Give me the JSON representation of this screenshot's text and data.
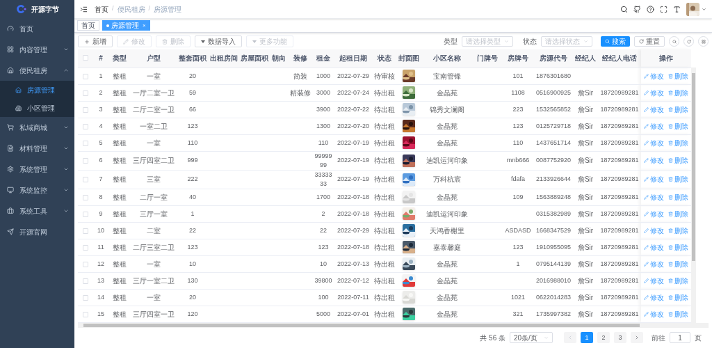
{
  "logo": {
    "title": "开源字节"
  },
  "sidebar": {
    "items": [
      {
        "label": "首页",
        "selected": false
      },
      {
        "label": "内容管理",
        "expanded": false,
        "selected": false
      },
      {
        "label": "便民租房",
        "expanded": true,
        "selected": false,
        "children": [
          {
            "label": "房源管理",
            "selected": true
          },
          {
            "label": "小区管理",
            "selected": false
          }
        ]
      },
      {
        "label": "私域商城",
        "expanded": false,
        "selected": false
      },
      {
        "label": "材料管理",
        "expanded": false,
        "selected": false
      },
      {
        "label": "系统管理",
        "expanded": false,
        "selected": false
      },
      {
        "label": "系统监控",
        "expanded": false,
        "selected": false
      },
      {
        "label": "系统工具",
        "expanded": false,
        "selected": false
      },
      {
        "label": "开源官网",
        "selected": false
      }
    ]
  },
  "breadcrumb": {
    "items": [
      "首页",
      "便民租房",
      "房源管理"
    ],
    "separators": [
      "/",
      "/"
    ]
  },
  "tags": [
    {
      "label": "首页",
      "selected": false
    },
    {
      "label": "房源管理",
      "selected": true,
      "close": "×"
    }
  ],
  "toolbar": {
    "buttons": [
      {
        "label": "新增",
        "disabled": false,
        "kind": "plus"
      },
      {
        "label": "修改",
        "disabled": true,
        "kind": "edit"
      },
      {
        "label": "删除",
        "disabled": true,
        "kind": "delete"
      },
      {
        "label": "数据导入",
        "disabled": false,
        "kind": "dropdown"
      },
      {
        "label": "更多功能",
        "disabled": true,
        "kind": "dropdown"
      }
    ],
    "filters": [
      {
        "label": "类型",
        "placeholder": "请选择类型"
      },
      {
        "label": "状态",
        "placeholder": "请选择状态"
      }
    ],
    "search": "搜索",
    "reset": "重置"
  },
  "table": {
    "columns": [
      "#",
      "类型",
      "户型",
      "整套面积",
      "出租房间",
      "房屋面积",
      "朝向",
      "装修",
      "租金",
      "起租日期",
      "状态",
      "封面图",
      "小区名称",
      "门牌号",
      "房牌号",
      "房源代号",
      "经纪人",
      "经纪人电话",
      "操作"
    ],
    "header_checked": false,
    "rows": [
      {
        "checked": false,
        "cells": [
          "1",
          "整租",
          "一室",
          "20",
          "",
          "",
          "",
          "简装",
          "1000",
          "2022-07-29",
          "待审核",
          "",
          "宝南管锋",
          "",
          "101",
          "1876301680",
          "",
          ""
        ]
      },
      {
        "checked": false,
        "cells": [
          "2",
          "整租",
          "一厅二室一卫",
          "59",
          "",
          "",
          "",
          "精装修",
          "3000",
          "2022-07-24",
          "待出租",
          "",
          "金晶苑",
          "",
          "1108",
          "0516900925",
          "詹Sir",
          "18720989281"
        ]
      },
      {
        "checked": false,
        "cells": [
          "3",
          "整租",
          "二厅二室一卫",
          "66",
          "",
          "",
          "",
          "",
          "3900",
          "2022-07-22",
          "待出租",
          "",
          "锦秀文澜阁",
          "",
          "223",
          "1532565852",
          "詹Sir",
          "18720989281"
        ]
      },
      {
        "checked": false,
        "cells": [
          "4",
          "整租",
          "一室二卫",
          "123",
          "",
          "",
          "",
          "",
          "1300",
          "2022-07-20",
          "待出租",
          "",
          "金晶苑",
          "",
          "123",
          "0125729718",
          "詹Sir",
          "18720989281"
        ]
      },
      {
        "checked": false,
        "cells": [
          "5",
          "整租",
          "一室",
          "110",
          "",
          "",
          "",
          "",
          "110",
          "2022-07-19",
          "待出租",
          "",
          "金晶苑",
          "",
          "110",
          "1437651714",
          "詹Sir",
          "18720989281"
        ]
      },
      {
        "checked": false,
        "cells": [
          "6",
          "整租",
          "三厅四室二卫",
          "999",
          "",
          "",
          "",
          "",
          "9999999",
          "2022-07-19",
          "待出租",
          "",
          "迪凯运河印象",
          "",
          "mnb666",
          "0087752920",
          "詹Sir",
          "18720989281"
        ]
      },
      {
        "checked": false,
        "cells": [
          "7",
          "整租",
          "三室",
          "222",
          "",
          "",
          "",
          "",
          "3333333",
          "2022-07-19",
          "待出租",
          "",
          "万科杭宸",
          "",
          "fdafa",
          "2133926644",
          "詹Sir",
          "18720989281"
        ]
      },
      {
        "checked": false,
        "cells": [
          "8",
          "整租",
          "二厅一室",
          "40",
          "",
          "",
          "",
          "",
          "1700",
          "2022-07-18",
          "待出租",
          "",
          "金晶苑",
          "",
          "109",
          "1563889248",
          "詹Sir",
          "18720989281"
        ]
      },
      {
        "checked": false,
        "cells": [
          "9",
          "整租",
          "三厅一室",
          "1",
          "",
          "",
          "",
          "",
          "2",
          "2022-07-18",
          "待出租",
          "",
          "迪凯运河印象",
          "",
          "",
          "0315382989",
          "詹Sir",
          "18720989281"
        ]
      },
      {
        "checked": false,
        "cells": [
          "10",
          "整租",
          "二室",
          "22",
          "",
          "",
          "",
          "",
          "22",
          "2022-07-29",
          "待出租",
          "",
          "天鸿香榭里",
          "",
          "ASDASD",
          "1668347529",
          "詹Sir",
          "18720989281"
        ]
      },
      {
        "checked": false,
        "cells": [
          "11",
          "整租",
          "二厅三室二卫",
          "123",
          "",
          "",
          "",
          "",
          "123",
          "2022-07-18",
          "待出租",
          "",
          "嘉泰馨庭",
          "",
          "123",
          "1910955095",
          "詹Sir",
          "18720989281"
        ]
      },
      {
        "checked": false,
        "cells": [
          "12",
          "整租",
          "一室",
          "10",
          "",
          "",
          "",
          "",
          "10",
          "2022-07-13",
          "待出租",
          "",
          "金晶苑",
          "",
          "1",
          "0795144139",
          "詹Sir",
          "18720989281"
        ]
      },
      {
        "checked": false,
        "cells": [
          "13",
          "整租",
          "三厅一室二卫",
          "130",
          "",
          "",
          "",
          "",
          "39800",
          "2022-07-12",
          "待出租",
          "",
          "金晶苑",
          "",
          "",
          "2016988010",
          "詹Sir",
          "18720989281"
        ]
      },
      {
        "checked": false,
        "cells": [
          "14",
          "整租",
          "一室",
          "20",
          "",
          "",
          "",
          "",
          "100",
          "2022-07-11",
          "待出租",
          "",
          "金晶苑",
          "",
          "1021",
          "0622014283",
          "詹Sir",
          "18720989281"
        ]
      },
      {
        "checked": false,
        "cells": [
          "15",
          "整租",
          "三厅四室一卫",
          "120",
          "",
          "",
          "",
          "",
          "5000",
          "2022-07-01",
          "待出租",
          "",
          "金晶苑",
          "",
          "321",
          "1735997382",
          "詹Sir",
          "18720989281"
        ]
      }
    ],
    "row_actions": [
      [
        "修改",
        "删除"
      ],
      [
        "修改",
        "删除"
      ],
      [
        "修改",
        "删除"
      ],
      [
        "修改",
        "删除"
      ],
      [
        "修改",
        "删除"
      ],
      [
        "修改",
        "删除"
      ],
      [
        "修改",
        "删除"
      ],
      [
        "修改",
        "删除"
      ],
      [
        "修改",
        "删除"
      ],
      [
        "修改",
        "删除"
      ],
      [
        "修改",
        "删除"
      ],
      [
        "修改",
        "删除"
      ],
      [
        "修改",
        "删除"
      ],
      [
        "修改",
        "删除"
      ],
      [
        "修改",
        "删除"
      ]
    ]
  },
  "pagination": {
    "total": "共 56 条",
    "page_size": "20条/页",
    "pages": [
      {
        "label": "1",
        "selected": true
      },
      {
        "label": "2",
        "selected": false
      },
      {
        "label": "3",
        "selected": false
      }
    ],
    "goto_label": "前往",
    "goto_value": "1",
    "goto_unit": "页"
  }
}
